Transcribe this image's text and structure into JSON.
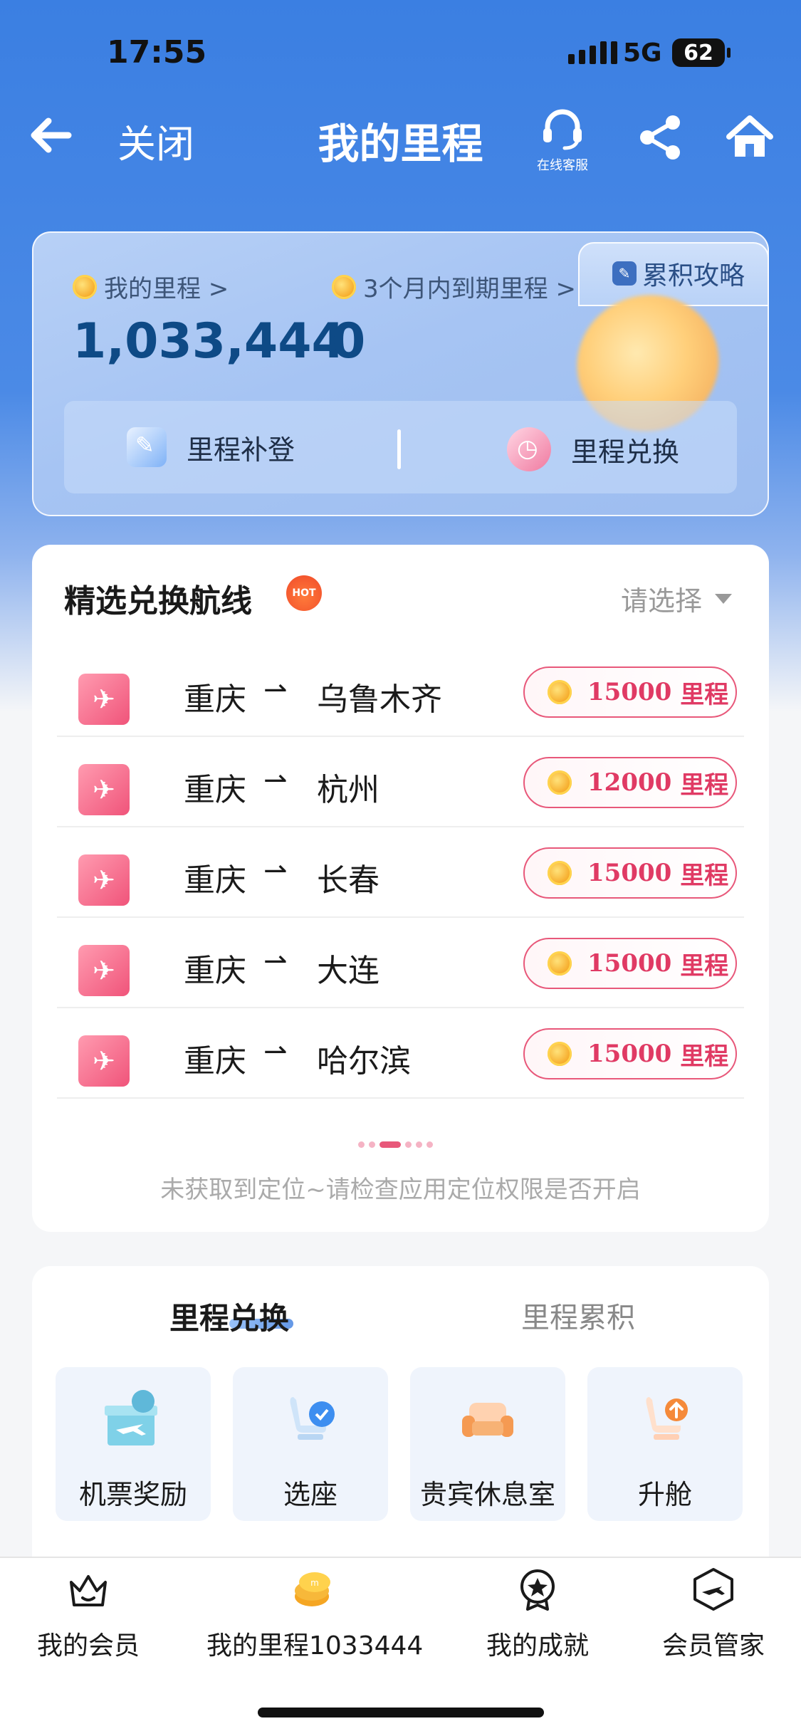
{
  "status_bar": {
    "time": "17:55",
    "network": "5G",
    "battery": "62"
  },
  "nav": {
    "close_label": "关闭",
    "title": "我的里程",
    "service_label": "在线客服"
  },
  "miles_card": {
    "guide_label": "累积攻略",
    "my_miles_label": "我的里程 >",
    "my_miles_value": "1,033,444",
    "expiring_label": "3个月内到期里程 >",
    "expiring_value": "0",
    "actions": [
      {
        "label": "里程补登",
        "icon": "pencil-icon"
      },
      {
        "label": "里程兑换",
        "icon": "clock-icon"
      }
    ]
  },
  "routes": {
    "title": "精选兑换航线",
    "hot_badge": "HOT",
    "select_label": "请选择",
    "arrow": "⇀",
    "items": [
      {
        "from": "重庆",
        "to": "乌鲁木齐",
        "miles": "15000",
        "unit": "里程"
      },
      {
        "from": "重庆",
        "to": "杭州",
        "miles": "12000",
        "unit": "里程"
      },
      {
        "from": "重庆",
        "to": "长春",
        "miles": "15000",
        "unit": "里程"
      },
      {
        "from": "重庆",
        "to": "大连",
        "miles": "15000",
        "unit": "里程"
      },
      {
        "from": "重庆",
        "to": "哈尔滨",
        "miles": "15000",
        "unit": "里程"
      }
    ],
    "location_message": "未获取到定位~请检查应用定位权限是否开启"
  },
  "redeem": {
    "tabs": [
      "里程兑换",
      "里程累积"
    ],
    "active_tab": 0,
    "tiles": [
      {
        "label": "机票奖励",
        "icon": "gift-plane-icon"
      },
      {
        "label": "选座",
        "icon": "seat-icon"
      },
      {
        "label": "贵宾休息室",
        "icon": "sofa-icon"
      },
      {
        "label": "升舱",
        "icon": "upgrade-seat-icon"
      }
    ]
  },
  "bottom_nav": [
    {
      "label": "我的会员",
      "icon": "crown-icon"
    },
    {
      "label": "我的里程1033444",
      "icon": "coins-icon"
    },
    {
      "label": "我的成就",
      "icon": "medal-icon"
    },
    {
      "label": "会员管家",
      "icon": "butler-plane-icon"
    }
  ],
  "colors": {
    "brand_blue": "#3b7fe2",
    "accent_pink": "#e8587a",
    "miles_blue": "#0e4a86"
  }
}
